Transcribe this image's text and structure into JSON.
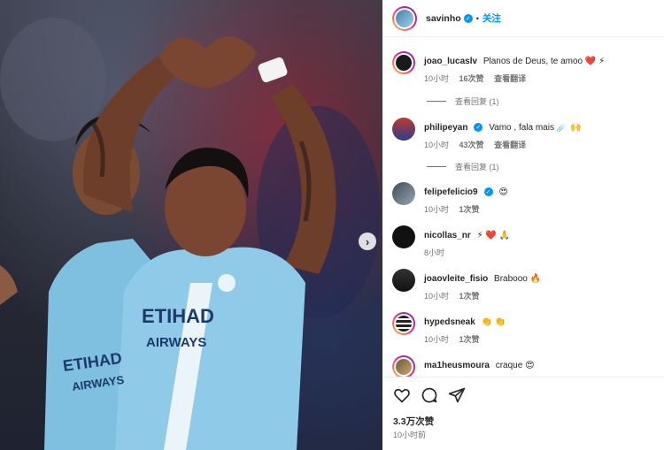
{
  "post": {
    "author": "savinho",
    "follow_label": "关注",
    "dot": "•"
  },
  "comments": [
    {
      "user": "joao_lucaslv",
      "text": "Planos de Deus, te amoo",
      "emojis": "❤️ ⚡",
      "time": "10小时",
      "likes": "16次赞",
      "translate": "查看翻译",
      "replies": "查看回复 (1)",
      "verified": false,
      "avatar_color": "#1a1a1a",
      "ring": true
    },
    {
      "user": "philipeyan",
      "text": "Vamo , fala mais",
      "emojis": "☄️ 🙌",
      "time": "10小时",
      "likes": "43次赞",
      "translate": "查看翻译",
      "replies": "查看回复 (1)",
      "verified": true,
      "avatar_color": "#c0392b",
      "ring": false
    },
    {
      "user": "felipefelicio9",
      "text": "",
      "emojis": "😍",
      "time": "10小时",
      "likes": "1次赞",
      "verified": true,
      "avatar_color": "#5a6470",
      "ring": false
    },
    {
      "user": "nicollas_nr",
      "text": "",
      "emojis": "⚡ ❤️ 🙏",
      "time": "8小时",
      "verified": false,
      "avatar_color": "#111111",
      "ring": false
    },
    {
      "user": "joaovleite_fisio",
      "text": "Brabooo",
      "emojis": "🔥",
      "time": "10小时",
      "likes": "1次赞",
      "verified": false,
      "avatar_color": "#222222",
      "ring": false
    },
    {
      "user": "hypedsneak",
      "text": "",
      "emojis": "👏 👏",
      "time": "10小时",
      "likes": "1次赞",
      "verified": false,
      "avatar_color": "#2b2b2b",
      "ring": true
    },
    {
      "user": "ma1heusmoura",
      "text": "craque",
      "emojis": "😍",
      "time": "",
      "likes": "",
      "verified": false,
      "avatar_color": "#6b5a3a",
      "ring": true
    }
  ],
  "footer": {
    "likes": "3.3万次赞",
    "posted": "10小时前"
  },
  "icons": {
    "carousel_next": "›",
    "like": "heart-icon",
    "comment": "comment-icon",
    "share": "share-icon"
  },
  "photo": {
    "jersey_text_1": "ETIHAD",
    "jersey_text_2": "AIRWAYS",
    "jersey_text_3": "ETIHAD",
    "jersey_text_4": "AIRWAYS"
  },
  "colors": {
    "accent": "#0095f6",
    "jersey": "#8fcbe8"
  }
}
